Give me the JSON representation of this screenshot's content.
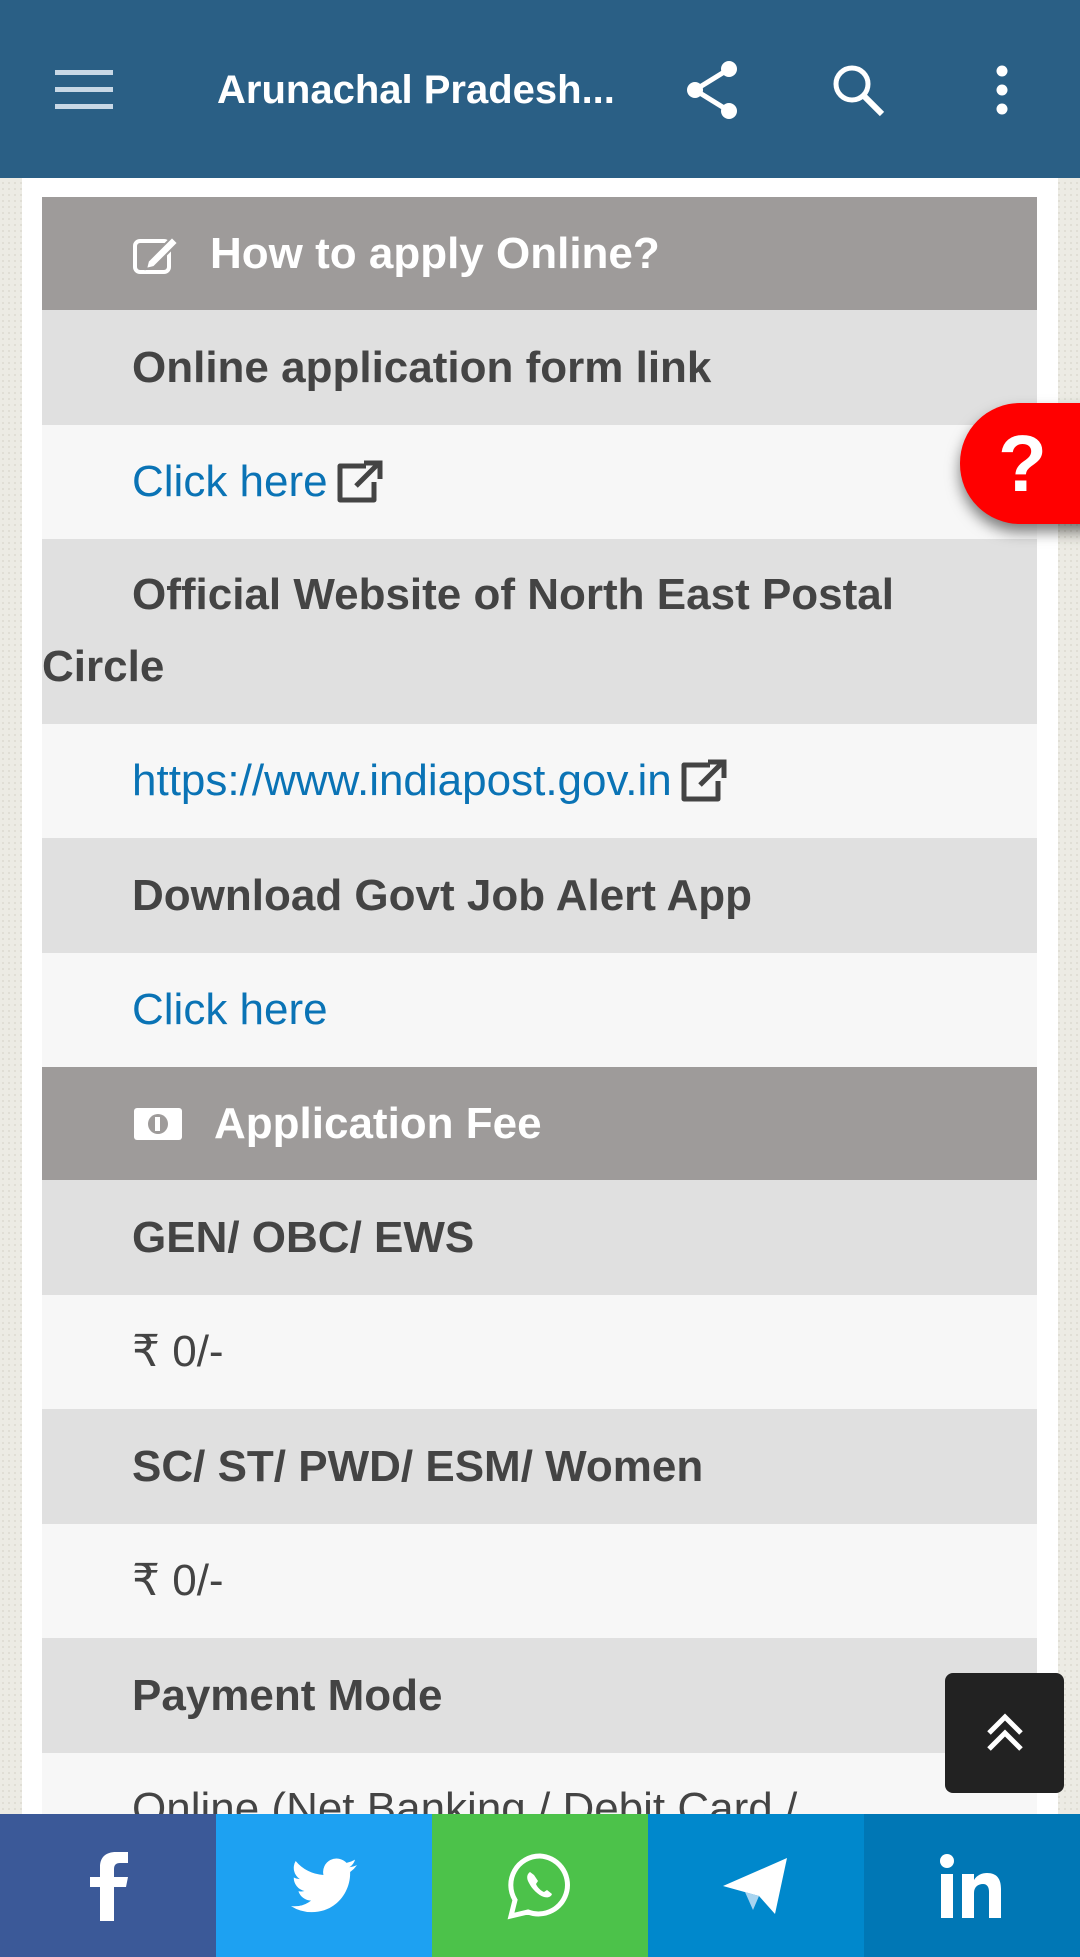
{
  "header": {
    "title": "Arunachal Pradesh...",
    "icons": [
      "menu-icon",
      "share-icon",
      "search-icon",
      "more-vert-icon"
    ],
    "color": "#2a5f85"
  },
  "table": {
    "apply_heading": "How to apply Online?",
    "form_link_label": "Online application form link",
    "form_link_value": "Click here",
    "website_label": "Official Website of North East Postal Circle",
    "website_value": "https://www.indiapost.gov.in",
    "app_label": "Download Govt Job Alert App",
    "app_value": "Click here",
    "fee_heading": "Application Fee",
    "fee_general_label": "GEN/ OBC/ EWS",
    "fee_general_value": "₹ 0/-",
    "fee_reserved_label": "SC/ ST/ PWD/ ESM/ Women",
    "fee_reserved_value": "₹ 0/-",
    "payment_label": "Payment Mode",
    "payment_value": "Online (Net Banking / Debit Card /"
  },
  "help_label": "?",
  "share_bar": [
    {
      "name": "facebook",
      "color": "#3b5998"
    },
    {
      "name": "twitter",
      "color": "#1da1f2"
    },
    {
      "name": "whatsapp",
      "color": "#4cc24a"
    },
    {
      "name": "telegram",
      "color": "#0088cc"
    },
    {
      "name": "linkedin",
      "color": "#0077b5"
    }
  ]
}
